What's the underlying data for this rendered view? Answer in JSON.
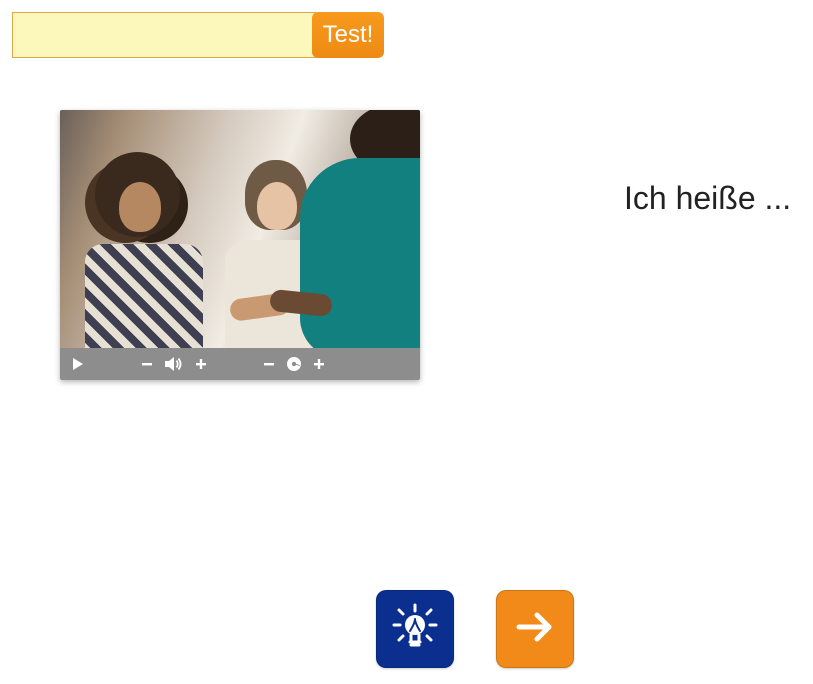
{
  "input": {
    "value": "",
    "placeholder": ""
  },
  "test_button": {
    "label": "Test!"
  },
  "prompt": {
    "text": "Ich heiße ..."
  },
  "controls": {
    "play": "play-icon",
    "vol_minus": "−",
    "vol_icon": "volume-icon",
    "vol_plus": "+",
    "speed_minus": "−",
    "speed_icon": "speed-icon",
    "speed_plus": "+"
  },
  "buttons": {
    "hint": "lightbulb-icon",
    "next": "arrow-right-icon"
  }
}
